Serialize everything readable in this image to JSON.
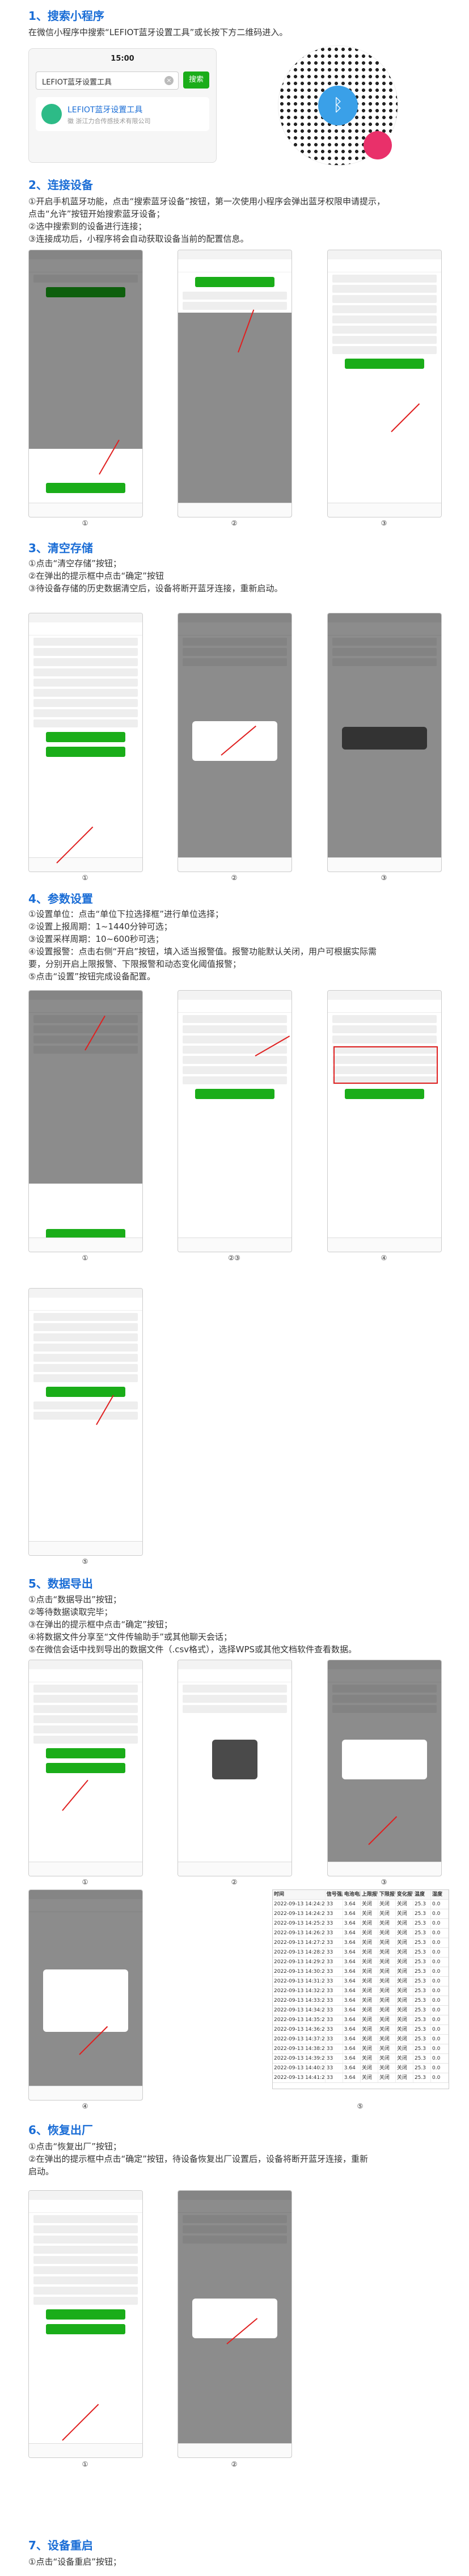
{
  "sections": [
    {
      "title": "1、搜索小程序",
      "lines": [
        "在微信小程序中搜索“LEFIOT蓝牙设置工具”或长按下方二维码进入。"
      ]
    },
    {
      "title": "2、连接设备",
      "lines": [
        "①开启手机蓝牙功能，点击“搜索蓝牙设备”按钮，第一次使用小程序会弹出蓝牙权限申请提示，",
        "点击“允许”按钮开始搜索蓝牙设备；",
        "②选中搜索到的设备进行连接；",
        "③连接成功后，小程序将会自动获取设备当前的配置信息。"
      ]
    },
    {
      "title": "3、清空存储",
      "lines": [
        "①点击“清空存储”按钮；",
        "②在弹出的提示框中点击“确定”按钮",
        "③待设备存储的历史数据清空后，设备将断开蓝牙连接，重新启动。"
      ]
    },
    {
      "title": "4、参数设置",
      "lines": [
        "①设置单位：点击“单位下拉选择框”进行单位选择；",
        "②设置上报周期：1~1440分钟可选；",
        "③设置采样周期：10~600秒可选；",
        "④设置报警：点击右侧“开启”按钮，填入适当报警值。报警功能默认关闭，用户可根据实际需",
        "要，分别开启上限报警、下限报警和动态变化阈值报警；",
        "⑤点击“设置”按钮完成设备配置。"
      ]
    },
    {
      "title": "5、数据导出",
      "lines": [
        "①点击“数据导出”按钮；",
        "②等待数据读取完毕；",
        "③在弹出的提示框中点击“确定”按钮；",
        "④将数据文件分享至“文件传输助手”或其他聊天会话；",
        "⑤在微信会话中找到导出的数据文件（.csv格式），选择WPS或其他文档软件查看数据。"
      ]
    },
    {
      "title": "6、恢复出厂",
      "lines": [
        "①点击“恢复出厂”按钮；",
        "②在弹出的提示框中点击“确定”按钮，待设备恢复出厂设置后，设备将断开蓝牙连接，重新",
        "启动。"
      ]
    },
    {
      "title": "7、设备重启",
      "lines": [
        "①点击“设备重启”按钮；"
      ]
    }
  ],
  "search_card": {
    "time": "15:00",
    "query": "LEFIOT蓝牙设置工具",
    "search_button": "搜索",
    "result_name": "LEFIOT蓝牙设置工具",
    "result_sub": "徽 浙江力合传感技术有限公司"
  },
  "icons": {
    "qr": "bluetooth-qr-icon"
  },
  "captions": {
    "connect": [
      "①",
      "②",
      "③"
    ],
    "clear": [
      "①",
      "②",
      "③"
    ],
    "params_row1": [
      "①",
      "②③",
      "④"
    ],
    "params_row2": [
      "⑤"
    ],
    "export_row1": [
      "①",
      "②",
      "③"
    ],
    "export_row2": [
      "④",
      "⑤"
    ],
    "reset": [
      "①",
      "②"
    ]
  },
  "export_table": {
    "headers": [
      "时间",
      "信号强度",
      "电池电压",
      "上限报警",
      "下限报警",
      "变化报警",
      "温度",
      "湿度"
    ],
    "rows": [
      [
        "2022-09-13 14:24:27",
        "33",
        "3.64",
        "关闭",
        "关闭",
        "关闭",
        "25.3",
        "0.0"
      ],
      [
        "2022-09-13 14:24:27",
        "33",
        "3.64",
        "关闭",
        "关闭",
        "关闭",
        "25.3",
        "0.0"
      ],
      [
        "2022-09-13 14:25:27",
        "33",
        "3.64",
        "关闭",
        "关闭",
        "关闭",
        "25.3",
        "0.0"
      ],
      [
        "2022-09-13 14:26:27",
        "33",
        "3.64",
        "关闭",
        "关闭",
        "关闭",
        "25.3",
        "0.0"
      ],
      [
        "2022-09-13 14:27:27",
        "33",
        "3.64",
        "关闭",
        "关闭",
        "关闭",
        "25.3",
        "0.0"
      ],
      [
        "2022-09-13 14:28:27",
        "33",
        "3.64",
        "关闭",
        "关闭",
        "关闭",
        "25.3",
        "0.0"
      ],
      [
        "2022-09-13 14:29:27",
        "33",
        "3.64",
        "关闭",
        "关闭",
        "关闭",
        "25.3",
        "0.0"
      ],
      [
        "2022-09-13 14:30:27",
        "33",
        "3.64",
        "关闭",
        "关闭",
        "关闭",
        "25.3",
        "0.0"
      ],
      [
        "2022-09-13 14:31:27",
        "33",
        "3.64",
        "关闭",
        "关闭",
        "关闭",
        "25.3",
        "0.0"
      ],
      [
        "2022-09-13 14:32:27",
        "33",
        "3.64",
        "关闭",
        "关闭",
        "关闭",
        "25.3",
        "0.0"
      ],
      [
        "2022-09-13 14:33:27",
        "33",
        "3.64",
        "关闭",
        "关闭",
        "关闭",
        "25.3",
        "0.0"
      ],
      [
        "2022-09-13 14:34:27",
        "33",
        "3.64",
        "关闭",
        "关闭",
        "关闭",
        "25.3",
        "0.0"
      ],
      [
        "2022-09-13 14:35:27",
        "33",
        "3.64",
        "关闭",
        "关闭",
        "关闭",
        "25.3",
        "0.0"
      ],
      [
        "2022-09-13 14:36:27",
        "33",
        "3.64",
        "关闭",
        "关闭",
        "关闭",
        "25.3",
        "0.0"
      ],
      [
        "2022-09-13 14:37:27",
        "33",
        "3.64",
        "关闭",
        "关闭",
        "关闭",
        "25.3",
        "0.0"
      ],
      [
        "2022-09-13 14:38:27",
        "33",
        "3.64",
        "关闭",
        "关闭",
        "关闭",
        "25.3",
        "0.0"
      ],
      [
        "2022-09-13 14:39:27",
        "33",
        "3.64",
        "关闭",
        "关闭",
        "关闭",
        "25.3",
        "0.0"
      ],
      [
        "2022-09-13 14:40:27",
        "33",
        "3.64",
        "关闭",
        "关闭",
        "关闭",
        "25.3",
        "0.0"
      ],
      [
        "2022-09-13 14:41:27",
        "33",
        "3.64",
        "关闭",
        "关闭",
        "关闭",
        "25.3",
        "0.0"
      ]
    ]
  },
  "colors": {
    "heading": "#1a6dd6",
    "accent": "#1aad19",
    "arrow": "#e02020"
  }
}
